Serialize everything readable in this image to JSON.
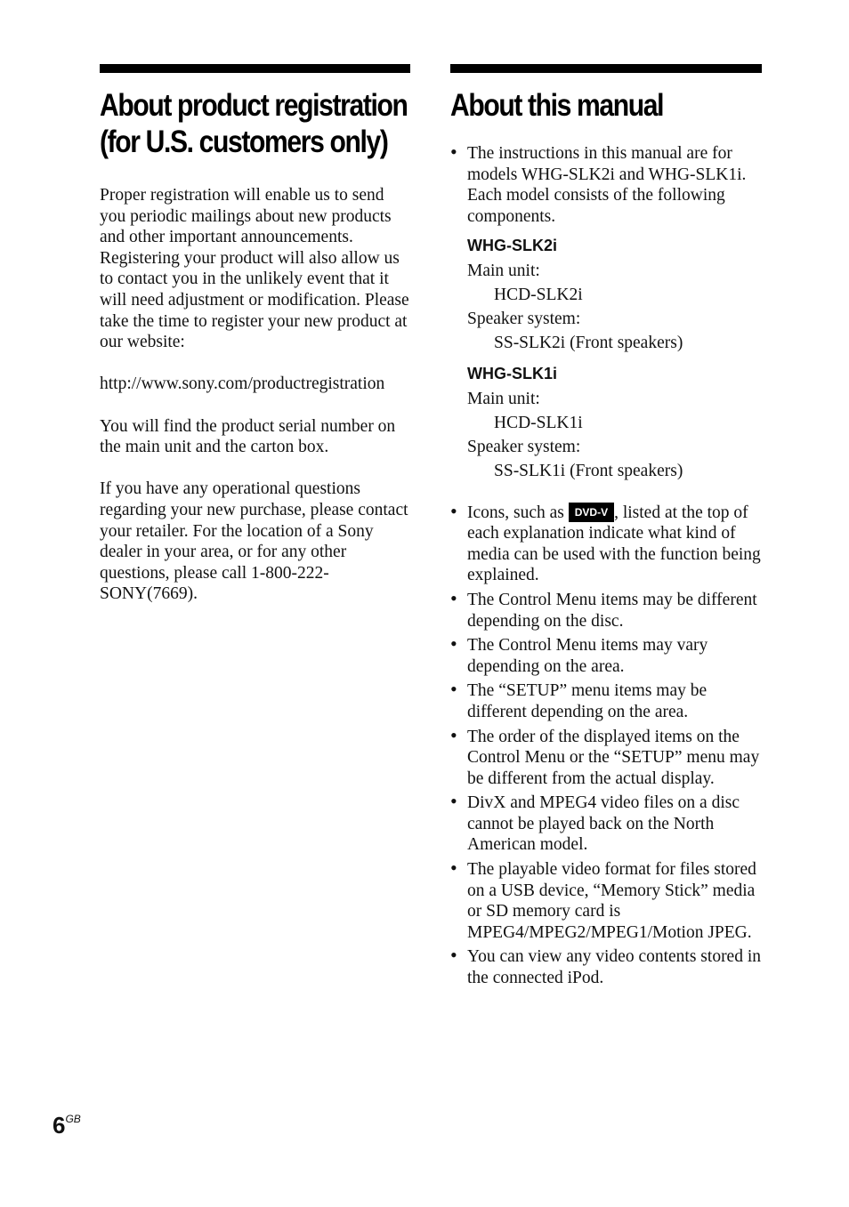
{
  "left": {
    "title": "About product registration (for U.S. customers only)",
    "paragraphs": [
      "Proper registration will enable us to send you periodic mailings about new products and other important announcements. Registering your product will also allow us to contact you in the unlikely event that it will need adjustment or modification. Please take the time to register your new product at our website:",
      "http://www.sony.com/productregistration",
      "You will find the product serial number on the main unit and the carton box.",
      "If you have any operational questions regarding your new purchase, please contact your retailer. For the location of a Sony dealer in your area, or for any other questions, please call 1-800-222-SONY(7669)."
    ]
  },
  "right": {
    "title": "About this manual",
    "intro_bullet": "The instructions in this manual are for models WHG-SLK2i and WHG-SLK1i. Each model consists of the following components.",
    "models": [
      {
        "name": "WHG-SLK2i",
        "main_unit_label": "Main unit:",
        "main_unit": "HCD-SLK2i",
        "speaker_label": "Speaker system:",
        "speaker": "SS-SLK2i (Front speakers)"
      },
      {
        "name": "WHG-SLK1i",
        "main_unit_label": "Main unit:",
        "main_unit": "HCD-SLK1i",
        "speaker_label": "Speaker system:",
        "speaker": "SS-SLK1i (Front speakers)"
      }
    ],
    "icon_bullet_pre": "Icons, such as ",
    "icon_label": "DVD-V",
    "icon_bullet_post": ", listed at the top of each explanation indicate what kind of media can be used with the function being explained.",
    "bullets": [
      "The Control Menu items may be different depending on the disc.",
      "The Control Menu items may vary depending on the area.",
      "The “SETUP” menu items may be different depending on the area.",
      "The order of the displayed items on the Control Menu or the “SETUP” menu may be different from the actual display.",
      "DivX and MPEG4 video files on a disc cannot be played back on the North American model.",
      "The playable video format for files stored on a USB device, “Memory Stick” media or SD memory card is MPEG4/MPEG2/MPEG1/Motion JPEG.",
      "You can view any video contents stored in the connected iPod."
    ]
  },
  "footer": {
    "page_number": "6",
    "page_suffix": "GB"
  }
}
